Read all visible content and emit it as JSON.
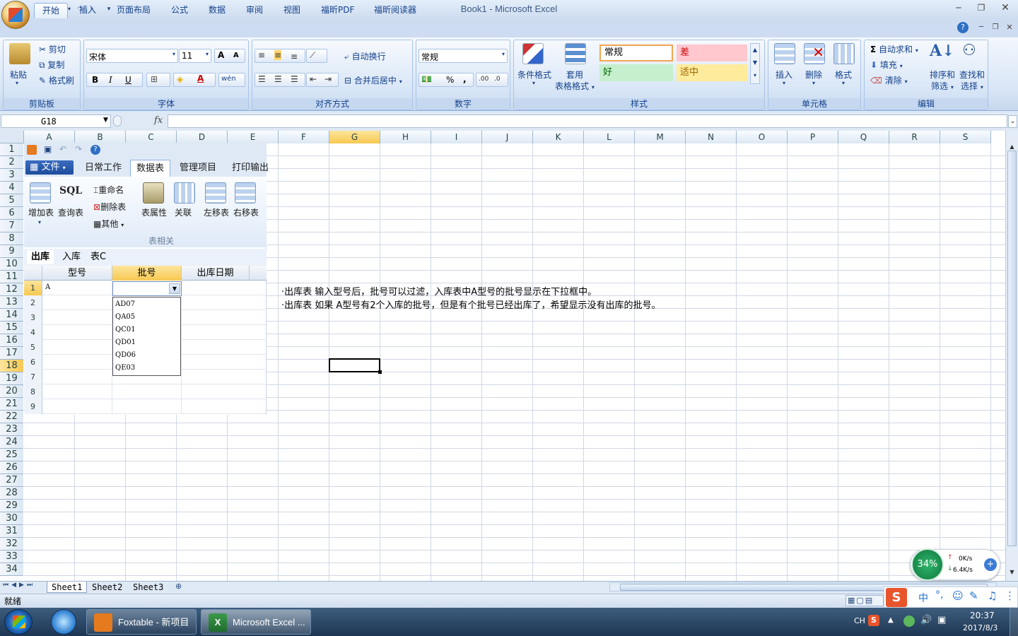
{
  "window": {
    "title": "Book1 - Microsoft Excel"
  },
  "ribbon_tabs": [
    "开始",
    "插入",
    "页面布局",
    "公式",
    "数据",
    "审阅",
    "视图",
    "福昕PDF",
    "福昕阅读器"
  ],
  "clipboard": {
    "paste": "粘贴",
    "cut": "剪切",
    "copy": "复制",
    "format_painter": "格式刷",
    "label": "剪贴板"
  },
  "font": {
    "name": "宋体",
    "size": "11",
    "label": "字体",
    "bold": "B",
    "italic": "I",
    "underline": "U",
    "grow": "A",
    "shrink": "A",
    "wen": "wén"
  },
  "alignment": {
    "wrap": "自动换行",
    "merge": "合并后居中",
    "label": "对齐方式"
  },
  "number": {
    "format": "常规",
    "percent": "%",
    "comma": ",",
    "label": "数字"
  },
  "styles": {
    "conditional": "条件格式",
    "table1": "套用",
    "table2": "表格格式",
    "normal": "常规",
    "bad": "差",
    "good": "好",
    "neutral": "适中",
    "label": "样式"
  },
  "cells": {
    "insert": "插入",
    "delete": "删除",
    "format": "格式",
    "label": "单元格"
  },
  "editing": {
    "autosum": "自动求和",
    "fill": "填充",
    "clear": "清除",
    "sort1": "排序和",
    "sort2": "筛选",
    "find1": "查找和",
    "find2": "选择",
    "label": "编辑"
  },
  "formula_bar": {
    "name_box": "G18",
    "fx": "fx",
    "value": ""
  },
  "columns": [
    "A",
    "B",
    "C",
    "D",
    "E",
    "F",
    "G",
    "H",
    "I",
    "J",
    "K",
    "L",
    "M",
    "N",
    "O",
    "P",
    "Q",
    "R",
    "S"
  ],
  "rows": [
    "1",
    "2",
    "3",
    "4",
    "5",
    "6",
    "7",
    "8",
    "9",
    "10",
    "11",
    "12",
    "13",
    "14",
    "15",
    "16",
    "17",
    "18",
    "19",
    "20",
    "21",
    "22",
    "23",
    "24",
    "25",
    "26",
    "27",
    "28",
    "29",
    "30",
    "31",
    "32",
    "33",
    "34"
  ],
  "notes": [
    "·出库表 输入型号后，批号可以过滤，入库表中A型号的批号显示在下拉框中。",
    "·出库表 如果 A型号有2个入库的批号，但是有个批号已经出库了，希望显示没有出库的批号。"
  ],
  "foxtable": {
    "tabs": [
      "文件",
      "日常工作",
      "数据表",
      "管理项目",
      "打印输出"
    ],
    "buttons": {
      "add_table": "增加表",
      "sql": "SQL",
      "query_table": "查询表",
      "rename": "重命名",
      "delete_table": "删除表",
      "other": "其他",
      "table_props": "表属性",
      "relation": "关联",
      "move_left": "左移表",
      "move_right": "右移表",
      "group_label": "表相关"
    },
    "sheets": [
      "出库",
      "入库",
      "表C"
    ],
    "grid_headers": [
      "型号",
      "批号",
      "出库日期"
    ],
    "row_numbers": [
      "1",
      "2",
      "3",
      "4",
      "5",
      "6",
      "7",
      "8",
      "9"
    ],
    "cell_value": "A",
    "dropdown_items": [
      "AD07",
      "QA05",
      "QC01",
      "QD01",
      "QD06",
      "QE03"
    ]
  },
  "sheet_tabs": [
    "Sheet1",
    "Sheet2",
    "Sheet3"
  ],
  "status": {
    "ready": "就绪"
  },
  "net_widget": {
    "percent": "34%",
    "up": "0K/s",
    "down": "6.4K/s"
  },
  "taskbar": {
    "items": [
      "Foxtable - 新项目",
      "Microsoft Excel ..."
    ],
    "tray_lang": "CH",
    "time": "20:37",
    "date": "2017/8/3",
    "ime": "中"
  }
}
